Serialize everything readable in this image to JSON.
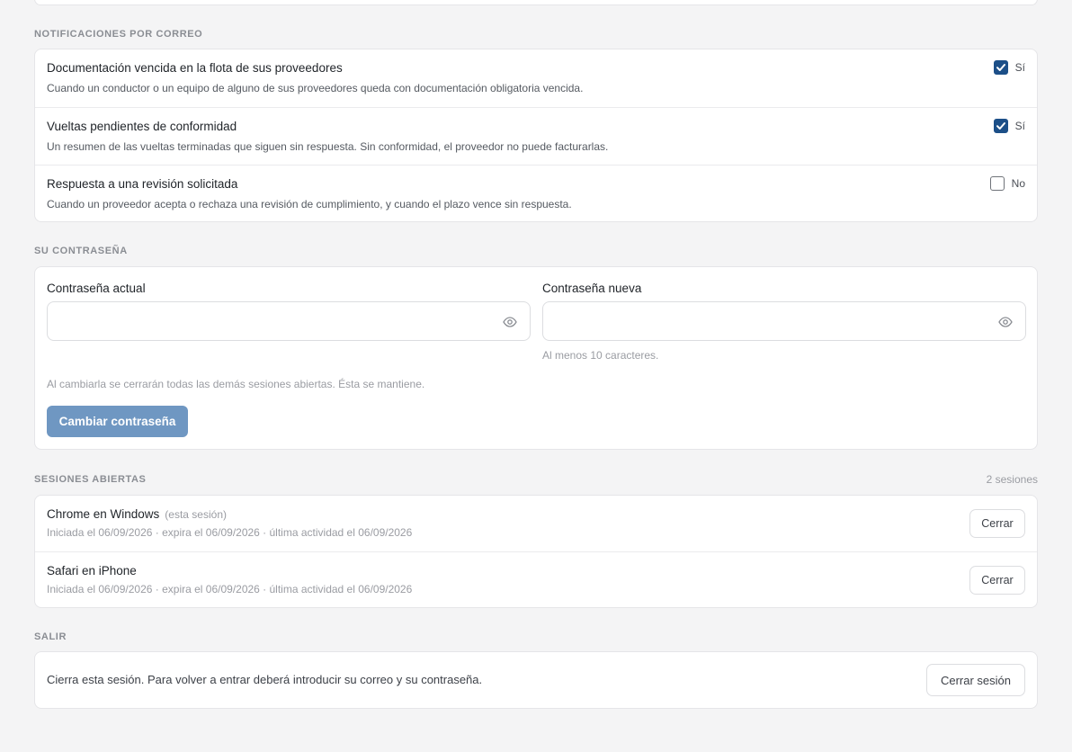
{
  "notifications": {
    "section_title": "NOTIFICACIONES POR CORREO",
    "items": [
      {
        "title": "Documentación vencida en la flota de sus proveedores",
        "description": "Cuando un conductor o un equipo de alguno de sus proveedores queda con documentación obligatoria vencida.",
        "checked": true,
        "value_label": "Sí"
      },
      {
        "title": "Vueltas pendientes de conformidad",
        "description": "Un resumen de las vueltas terminadas que siguen sin respuesta. Sin conformidad, el proveedor no puede facturarlas.",
        "checked": true,
        "value_label": "Sí"
      },
      {
        "title": "Respuesta a una revisión solicitada",
        "description": "Cuando un proveedor acepta o rechaza una revisión de cumplimiento, y cuando el plazo vence sin respuesta.",
        "checked": false,
        "value_label": "No"
      }
    ]
  },
  "password": {
    "section_title": "SU CONTRASEÑA",
    "current_label": "Contraseña actual",
    "current_value": "",
    "new_label": "Contraseña nueva",
    "new_value": "",
    "new_hint": "Al menos 10 caracteres.",
    "note": "Al cambiarla se cerrarán todas las demás sesiones abiertas. Ésta se mantiene.",
    "button_label": "Cambiar contraseña",
    "eye_icon": "eye-icon"
  },
  "sessions": {
    "section_title": "SESIONES ABIERTAS",
    "count_label": "2 sesiones",
    "items": [
      {
        "device": "Chrome en Windows",
        "tag": "(esta sesión)",
        "meta": "Iniciada el 06/09/2026 · expira el 06/09/2026 · última actividad el 06/09/2026",
        "close_label": "Cerrar"
      },
      {
        "device": "Safari en iPhone",
        "tag": "",
        "meta": "Iniciada el 06/09/2026 · expira el 06/09/2026 · última actividad el 06/09/2026",
        "close_label": "Cerrar"
      }
    ]
  },
  "exit": {
    "section_title": "SALIR",
    "description": "Cierra esta sesión. Para volver a entrar deberá introducir su correo y su contraseña.",
    "button_label": "Cerrar sesión"
  },
  "colors": {
    "accent": "#1c4f88",
    "button_disabled": "#6f97c2",
    "background": "#f4f4f5"
  }
}
